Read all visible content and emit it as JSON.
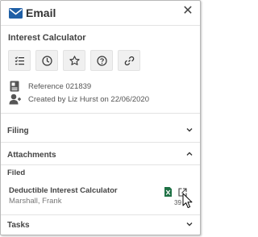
{
  "window": {
    "title": "Email",
    "close_glyph": "✕"
  },
  "calculator": {
    "title": "Interest Calculator"
  },
  "toolbar": {
    "buttons": [
      {
        "icon": "checklist-icon"
      },
      {
        "icon": "clock-icon"
      },
      {
        "icon": "star-icon"
      },
      {
        "icon": "help-icon"
      },
      {
        "icon": "link-icon"
      }
    ]
  },
  "info": {
    "reference": "Reference 021839",
    "created": "Created by Liz Hurst on 22/06/2020"
  },
  "sections": {
    "filing": "Filing",
    "attachments": "Attachments",
    "tasks": "Tasks"
  },
  "attachments": {
    "filed_label": "Filed",
    "items": [
      {
        "title": "Deductible Interest Calculator",
        "author": "Marshall, Frank",
        "count": "39",
        "file_icon": "excel-file-icon",
        "action_icon": "open-external-icon"
      }
    ]
  },
  "colors": {
    "accent": "#1f5fa6",
    "excel_green": "#1e7145",
    "toolbar_bg": "#f0f0f0",
    "separator": "#e3e3e3"
  }
}
